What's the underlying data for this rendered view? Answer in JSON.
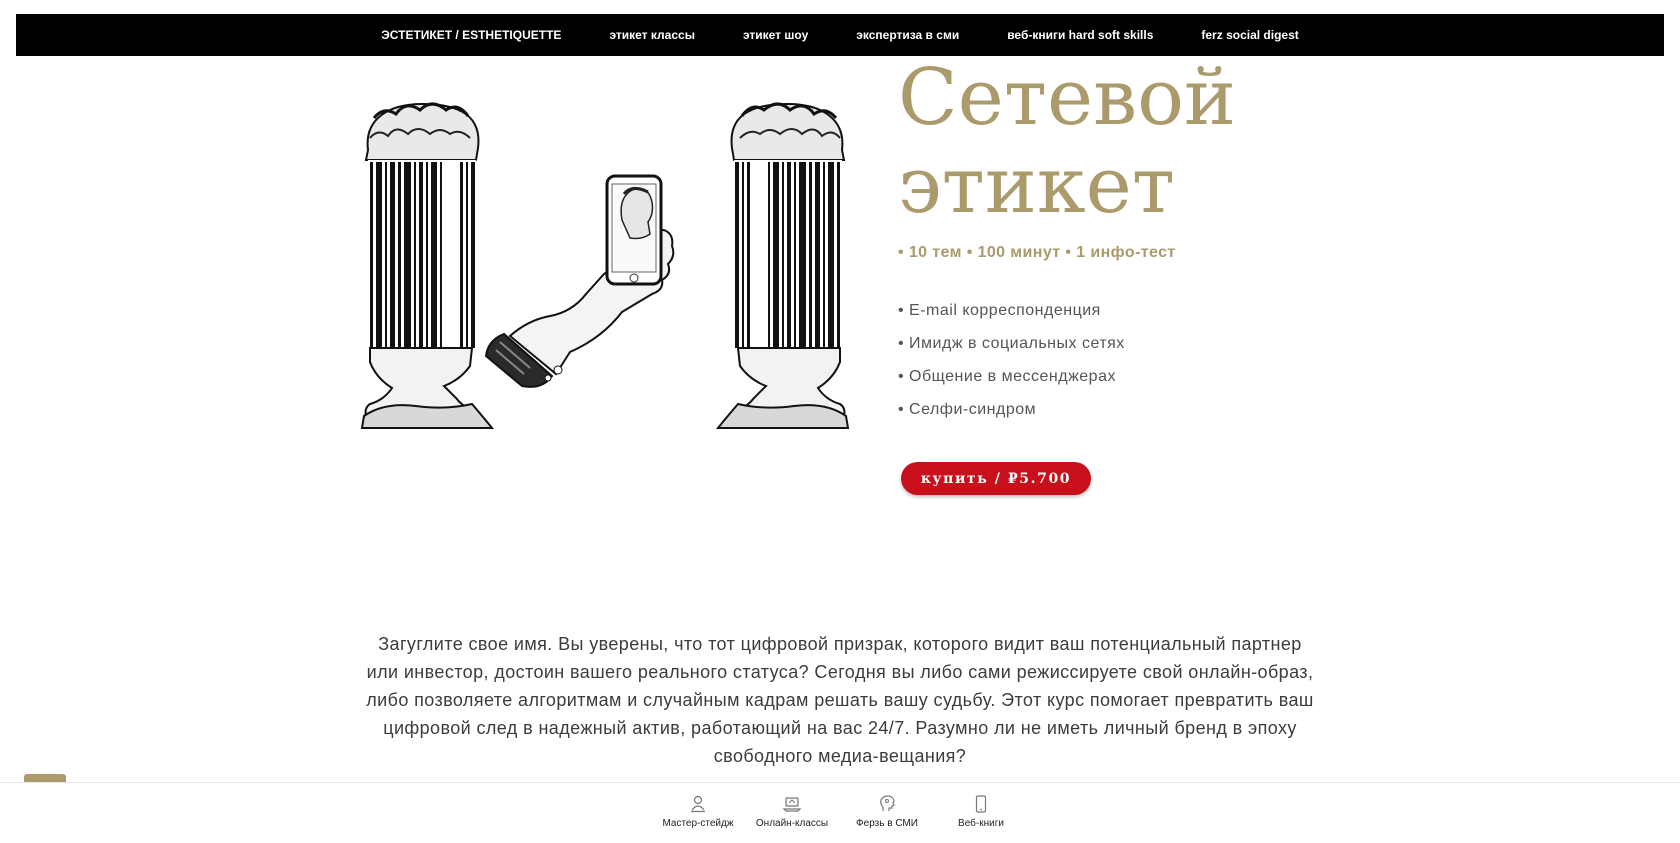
{
  "nav": {
    "items": [
      {
        "label": "ЭСТЕТИКЕТ / ESTHETIQUETTE"
      },
      {
        "label": "этикет классы"
      },
      {
        "label": "этикет шоу"
      },
      {
        "label": "экспертиза в сми"
      },
      {
        "label": "веб-книги hard soft skills"
      },
      {
        "label": "ferz social digest"
      }
    ]
  },
  "hero": {
    "title_line1": "Сетевой",
    "title_line2": "этикет",
    "meta": "• 10 тем • 100 минут • 1 инфо-тест",
    "topics": [
      "• E-mail корреспонденция",
      "• Имидж в социальных сетях",
      "• Общение в мессенджерах",
      "• Селфи-синдром"
    ],
    "buy_label": "купить / ₽5.700"
  },
  "intro": {
    "text": "Загуглите свое имя. Вы уверены, что тот цифровой призрак, которого видит ваш потенциальный партнер или инвестор, достоин вашего реального статуса? Сегодня вы либо сами режиссируете свой онлайн-образ, либо позволяете алгоритмам и случайным кадрам решать вашу судьбу. Этот курс помогает превратить ваш цифровой след в надежный актив, работающий на вас 24/7. Разумно ли не иметь личный бренд в эпоху свободного медиа-вещания?"
  },
  "bottom_nav": {
    "items": [
      {
        "label": "Мастер-стейдж",
        "icon": "person-stage-icon"
      },
      {
        "label": "Онлайн-классы",
        "icon": "laptop-icon"
      },
      {
        "label": "Ферзь в СМИ",
        "icon": "head-icon"
      },
      {
        "label": "Веб-книги",
        "icon": "phone-icon"
      }
    ]
  },
  "colors": {
    "accent_gold": "#ab9a6c",
    "buy_red": "#c8101c",
    "nav_bg": "#000000"
  }
}
